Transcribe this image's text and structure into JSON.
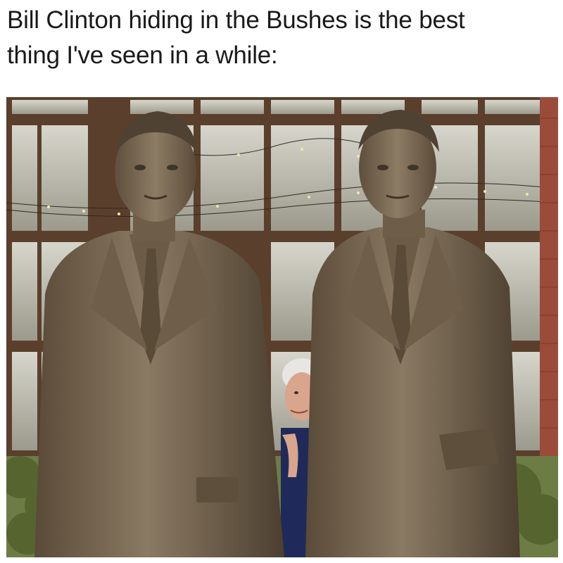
{
  "caption": {
    "line1": "Bill Clinton hiding in the Bushes is the best",
    "line2": "thing I've seen in a while:"
  },
  "photo": {
    "subjects": [
      "statue-left",
      "hiding-person",
      "statue-right"
    ],
    "colors": {
      "bronze": "#7a6a55",
      "bronze_dark": "#4f4233",
      "window_frame": "#5a3f2c",
      "glass": "#c9c8bd",
      "brick": "#9a4b3a",
      "hair": "#e8e6e2",
      "skin": "#d9a58c",
      "jacket": "#1f2a5a",
      "foliage": "#6d7c45"
    }
  }
}
